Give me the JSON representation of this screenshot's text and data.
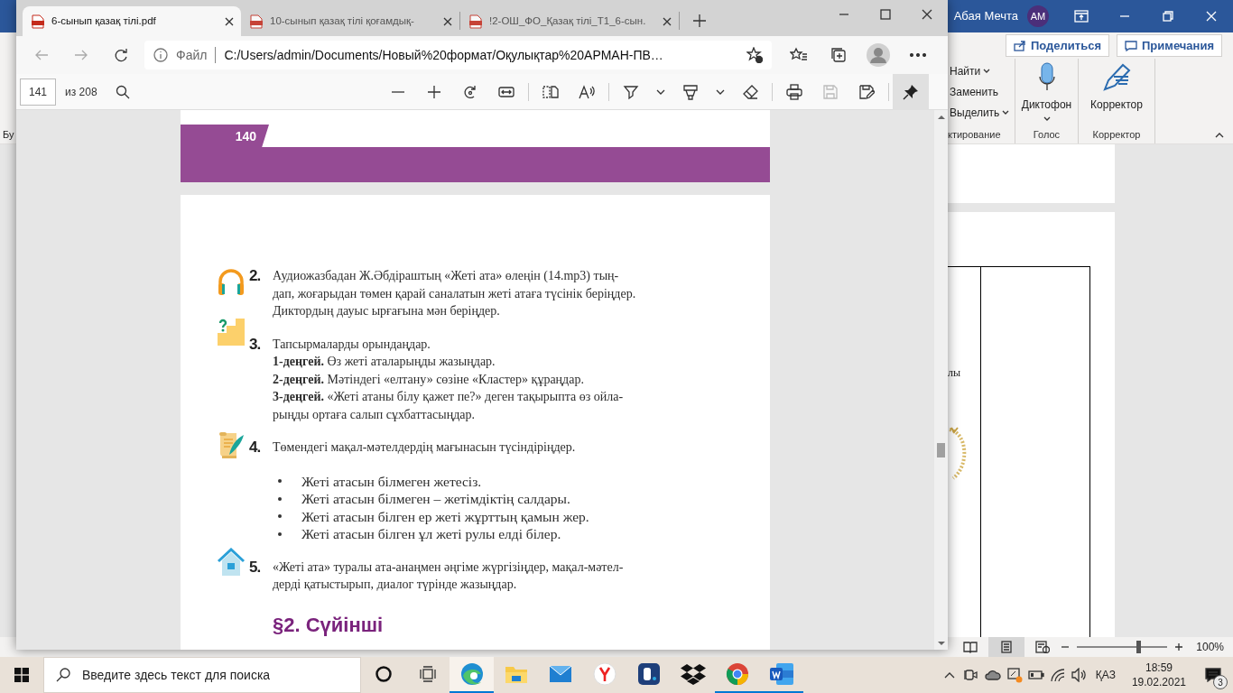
{
  "word_window": {
    "user_name": "Абая Мечта",
    "user_initials": "АМ",
    "share_button": "Поделиться",
    "comments_button": "Примечания",
    "left_fragment": "Бу",
    "editing_group": {
      "items": [
        {
          "label": "Найти",
          "has_menu": true
        },
        {
          "label": "Заменить",
          "has_menu": false
        },
        {
          "label": "Выделить",
          "has_menu": true
        }
      ],
      "title": "ктирование"
    },
    "voice_group": {
      "button": "Диктофон",
      "title": "Голос"
    },
    "editor_group": {
      "button": "Корректор",
      "title": "Корректор"
    },
    "document_fragment": "лы",
    "status_bar": {
      "views": [
        {
          "kind": "read",
          "selected": false
        },
        {
          "kind": "print",
          "selected": true
        },
        {
          "kind": "web",
          "selected": false
        }
      ],
      "zoom": {
        "level": 0.68,
        "reading": "100%"
      }
    }
  },
  "browser": {
    "tabs": [
      {
        "title": "6-сынып қазақ тілі.pdf",
        "selected": true
      },
      {
        "title": "10-сынып қазақ тілі қоғамдық-",
        "selected": false
      },
      {
        "title": "!2-ОШ_ФО_Қазақ тілі_Т1_6-сын.",
        "selected": false
      }
    ],
    "address": {
      "label": "Файл",
      "url": "C:/Users/admin/Documents/Новый%20формат/Оқулықтар%20АРМАН-ПВ…"
    },
    "pdf_toolbar": {
      "page": "141",
      "page_count": "из 208",
      "save_disabled": true,
      "pinned": true
    },
    "document": {
      "page_number": "140",
      "tasks": [
        {
          "kind": "listening",
          "number": "2.",
          "paragraphs": [
            [
              "Аудиожазбадан Ж.Әбдіраштың «Жеті ата» өлеңін (14.mp3) тың-",
              "дап, жоғарыдан төмен қарай саналатын жеті атаға түсінік беріңдер.",
              "Диктордың дауыс ырғағына мән беріңдер."
            ]
          ]
        },
        {
          "kind": "levels",
          "number": "3.",
          "paragraphs": [
            [
              "Тапсырмаларды орындаңдар."
            ],
            [
              "**1-деңгей.** Өз жеті аталарыңды жазыңдар."
            ],
            [
              "**2-деңгей.** Мәтіндегі «елтану» сөзіне «Кластер» құраңдар."
            ],
            [
              "**3-деңгей.** «Жеті атаны білу қажет пе?» деген тақырыпта өз ойла-",
              "рыңды ортаға салып сұхбаттасыңдар."
            ]
          ]
        },
        {
          "kind": "proverbs",
          "number": "4.",
          "paragraphs": [
            [
              "Төмендегі мақал-мәтелдердің мағынасын түсіндіріңдер."
            ]
          ],
          "bullets": [
            "Жеті атасын білмеген жетесіз.",
            "Жеті атасын білмеген – жетімдіктің салдары.",
            "Жеті атасын білген ер жеті жұрттың қамын жер.",
            "Жеті атасын білген ұл жеті рулы елді білер."
          ]
        },
        {
          "kind": "homework",
          "number": "5.",
          "paragraphs": [
            [
              "«Жеті ата» туралы ата-анаңмен әңгіме жүргізіңдер, мақал-мәтел-",
              "дерді қатыстырып, диалог түрінде жазыңдар."
            ]
          ]
        }
      ],
      "heading": "§2. Сүйінші"
    }
  },
  "taskbar": {
    "search": {
      "placeholder": "Введите здесь текст для поиска"
    },
    "apps": [
      {
        "kind": "edge",
        "running": true,
        "selected": true
      },
      {
        "kind": "explorer",
        "running": false,
        "selected": false
      },
      {
        "kind": "mail",
        "running": false,
        "selected": false
      },
      {
        "kind": "yandex",
        "running": false,
        "selected": false
      },
      {
        "kind": "booking",
        "running": false,
        "selected": false
      },
      {
        "kind": "dropbox",
        "running": false,
        "selected": false
      },
      {
        "kind": "chrome",
        "running": true,
        "selected": false
      },
      {
        "kind": "word",
        "running": true,
        "selected": false
      }
    ],
    "language": "ҚАЗ",
    "time": "18:59",
    "date": "19.02.2021",
    "notifications": "3"
  }
}
